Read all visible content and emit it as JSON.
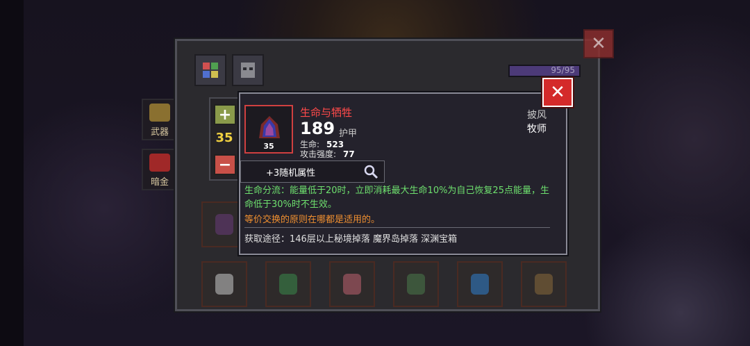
{
  "sidebar": {
    "tabs": [
      {
        "label": "武器",
        "color": "#b09030"
      },
      {
        "label": "暗金",
        "color": "#c03030"
      }
    ]
  },
  "panel": {
    "hp_text": "95/95",
    "close_glyph": "✕"
  },
  "stepper": {
    "plus": "+",
    "minus": "−",
    "quantity": "35"
  },
  "tooltip": {
    "close_glyph": "✕",
    "item_name": "生命与牺牲",
    "item_level": "35",
    "armor_value": "189",
    "armor_label": "护甲",
    "stats": [
      {
        "label": "生命:",
        "value": "523"
      },
      {
        "label": "攻击强度:",
        "value": "77"
      }
    ],
    "slot_type": "披风",
    "class_type": "牧师",
    "random_attr": "+3随机属性",
    "magnifier_icon": "magnifier-icon",
    "description": "生命分流：能量低于20时，立即消耗最大生命10%为自己恢复25点能量，生命低于30%时不生效。",
    "flavor": "等价交换的原则在哪都是适用的。",
    "source": "获取途径：146层以上秘境掉落 魔界岛掉落 深渊宝箱"
  },
  "colors": {
    "item_name": "#ff4a4a",
    "description": "#6ee06e",
    "flavor": "#f09030",
    "quantity": "#f0d040",
    "close": "#d42a2a"
  }
}
